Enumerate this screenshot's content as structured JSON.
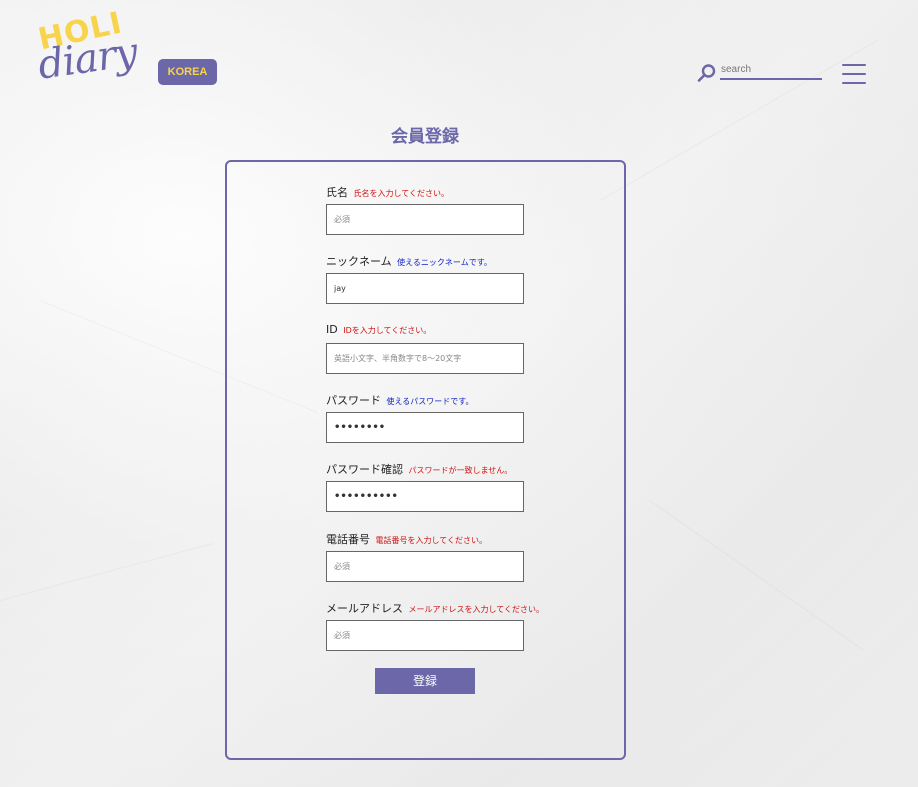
{
  "header": {
    "logo_top": "HOLI",
    "logo_bottom": "diary",
    "region_badge": "KOREA",
    "search_placeholder": "search",
    "search_icon": "search-icon",
    "menu_icon": "hamburger-menu-icon"
  },
  "page": {
    "title": "会員登録"
  },
  "colors": {
    "accent": "#6b67a8",
    "logo_yellow": "#f8d44c",
    "error": "#d01010",
    "ok": "#1020c8"
  },
  "form": {
    "fields": [
      {
        "label": "氏名",
        "message": "氏名を入力してください。",
        "status": "error",
        "value": "",
        "placeholder": "必須",
        "type": "text"
      },
      {
        "label": "ニックネーム",
        "message": "使えるニックネームです。",
        "status": "ok",
        "value": "jay",
        "placeholder": "",
        "type": "text"
      },
      {
        "label": "ID",
        "message": "IDを入力してください。",
        "status": "error",
        "value": "",
        "placeholder": "英語小文字、半角数字で8～20文字",
        "type": "text"
      },
      {
        "label": "パスワード",
        "message": "使えるパスワードです。",
        "status": "ok",
        "value": "••••••••",
        "placeholder": "",
        "type": "password"
      },
      {
        "label": "パスワード確認",
        "message": "パスワードが一致しません。",
        "status": "error",
        "value": "••••••••••",
        "placeholder": "",
        "type": "password"
      },
      {
        "label": "電話番号",
        "message": "電話番号を入力してください。",
        "status": "error",
        "value": "",
        "placeholder": "必須",
        "type": "text"
      },
      {
        "label": "メールアドレス",
        "message": "メールアドレスを入力してください。",
        "status": "error",
        "value": "",
        "placeholder": "必須",
        "type": "text"
      }
    ],
    "submit_label": "登録"
  }
}
